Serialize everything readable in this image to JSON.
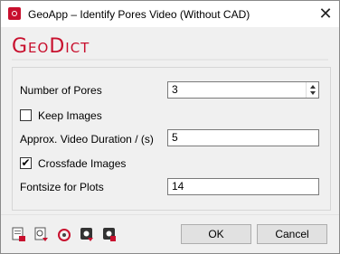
{
  "window": {
    "title": "GeoApp – Identify Pores Video (Without CAD)",
    "close_glyph": "✕",
    "app_icon": "geodict-app-icon"
  },
  "brand": {
    "logo_text": "GeoDict"
  },
  "form": {
    "num_pores": {
      "label": "Number of Pores",
      "value": "3"
    },
    "keep_images": {
      "label": "Keep Images",
      "checked": false,
      "mark": ""
    },
    "video_duration": {
      "label": "Approx. Video Duration / (s)",
      "value": "5"
    },
    "crossfade": {
      "label": "Crossfade Images",
      "checked": true,
      "mark": "✔"
    },
    "fontsize": {
      "label": "Fontsize for Plots",
      "value": "14"
    }
  },
  "toolbar": {
    "icons": [
      "load-settings-icon",
      "save-settings-icon",
      "reset-settings-icon",
      "macro-record-icon",
      "macro-stop-icon"
    ]
  },
  "buttons": {
    "ok": "OK",
    "cancel": "Cancel"
  },
  "colors": {
    "brand_red": "#c8102e",
    "window_bg": "#f0f0f0"
  }
}
